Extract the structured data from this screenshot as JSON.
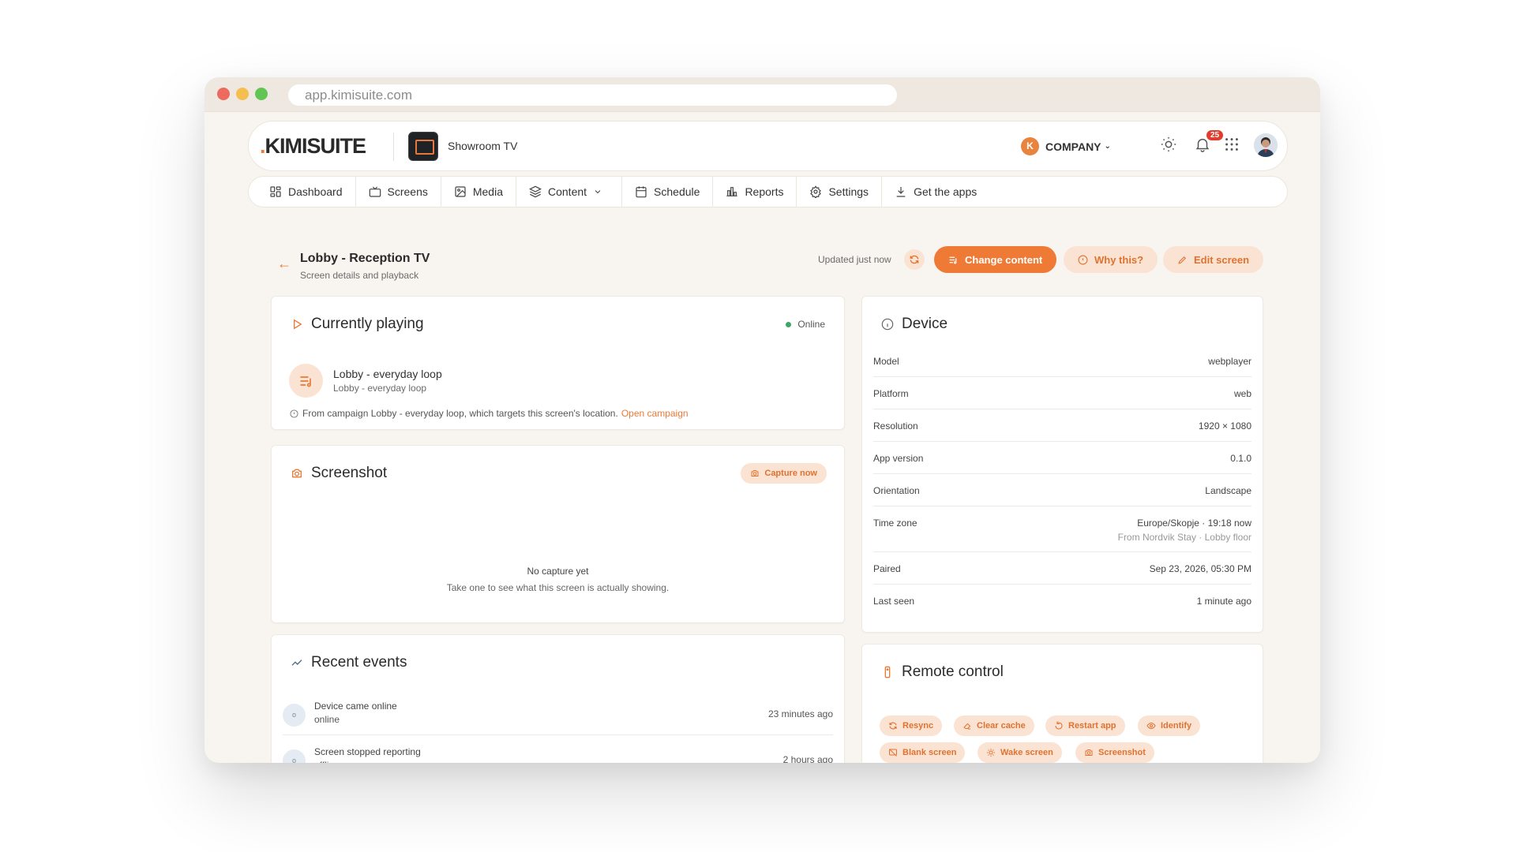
{
  "browser": {
    "url": "app.kimisuite.com"
  },
  "header": {
    "logo_dot": ".",
    "logo_text": "KIMISUITE",
    "screen_name": "Showroom TV",
    "company_initial": "K",
    "company_label": "COMPANY",
    "notifications_count": "25"
  },
  "nav": {
    "dashboard": "Dashboard",
    "screens": "Screens",
    "media": "Media",
    "content": "Content",
    "schedule": "Schedule",
    "reports": "Reports",
    "settings": "Settings",
    "get_apps": "Get the apps"
  },
  "page": {
    "title": "Lobby - Reception TV",
    "subtitle": "Screen details and playback",
    "updated": "Updated just now",
    "change_content": "Change content",
    "why_this": "Why this?",
    "edit_screen": "Edit screen"
  },
  "playing": {
    "title": "Currently playing",
    "status": "Online",
    "playlist_name": "Lobby - everyday loop",
    "playlist_sub": "Lobby - everyday loop",
    "note": "From campaign Lobby - everyday loop, which targets this screen's location.",
    "note_link": "Open campaign"
  },
  "screenshot": {
    "title": "Screenshot",
    "capture_label": "Capture now",
    "empty_title": "No capture yet",
    "empty_sub": "Take one to see what this screen is actually showing."
  },
  "events": {
    "title": "Recent events",
    "items": [
      {
        "icon": "o",
        "title": "Device came online",
        "sub": "online",
        "time": "23 minutes ago"
      },
      {
        "icon": "o",
        "title": "Screen stopped reporting",
        "sub": "offline",
        "time": "2 hours ago"
      }
    ]
  },
  "device": {
    "title": "Device",
    "rows": [
      {
        "key": "Model",
        "value": "webplayer"
      },
      {
        "key": "Platform",
        "value": "web"
      },
      {
        "key": "Resolution",
        "value": "1920 × 1080"
      },
      {
        "key": "App version",
        "value": "0.1.0"
      },
      {
        "key": "Orientation",
        "value": "Landscape"
      },
      {
        "key": "Time zone",
        "value": "Europe/Skopje · 19:18 now",
        "sub": "From Nordvik Stay · Lobby floor"
      },
      {
        "key": "Paired",
        "value": "Sep 23, 2026, 05:30 PM"
      },
      {
        "key": "Last seen",
        "value": "1 minute ago"
      }
    ]
  },
  "remote": {
    "title": "Remote control",
    "buttons": {
      "resync": "Resync",
      "clear_cache": "Clear cache",
      "restart_app": "Restart app",
      "identify": "Identify",
      "blank_screen": "Blank screen",
      "wake_screen": "Wake screen",
      "screenshot": "Screenshot"
    }
  },
  "colors": {
    "accent": "#ef7a35",
    "accent_soft": "#fbe3d3",
    "online": "#3fa66a",
    "badge": "#e03d2f"
  }
}
